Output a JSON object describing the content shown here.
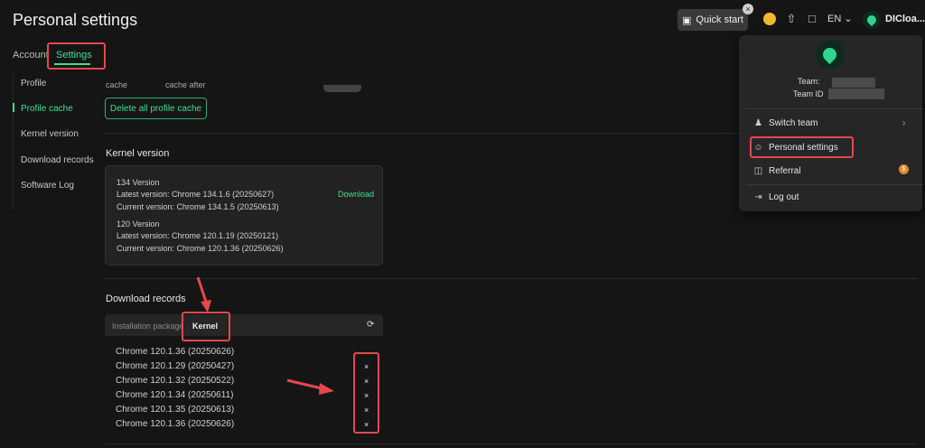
{
  "header": {
    "title": "Personal settings",
    "quick_start": "Quick start",
    "language": "EN",
    "user_name": "DICloa..."
  },
  "tabs": {
    "account": "Account",
    "settings": "Settings"
  },
  "sidebar": {
    "items": [
      {
        "label": "Profile"
      },
      {
        "label": "Profile cache",
        "active": true
      },
      {
        "label": "Kernel version"
      },
      {
        "label": "Download records"
      },
      {
        "label": "Software Log"
      }
    ]
  },
  "profile_cache": {
    "cut_label_1": "cache",
    "cut_label_2": "cache after",
    "delete_button": "Delete all profile cache"
  },
  "kernel_version": {
    "title": "Kernel version",
    "download_label": "Download",
    "versions": [
      {
        "name": "134 Version",
        "latest": "Latest version: Chrome 134.1.6 (20250627)",
        "current": "Current version: Chrome 134.1.5 (20250613)"
      },
      {
        "name": "120 Version",
        "latest": "Latest version: Chrome 120.1.19 (20250121)",
        "current": "Current version: Chrome 120.1.36 (20250626)"
      }
    ]
  },
  "download_records": {
    "title": "Download records",
    "tab_installation": "Installation package",
    "tab_kernel": "Kernel",
    "records": [
      "Chrome 120.1.36 (20250626)",
      "Chrome 120.1.29 (20250427)",
      "Chrome 120.1.32 (20250522)",
      "Chrome 120.1.34 (20250611)",
      "Chrome 120.1.35 (20250613)",
      "Chrome 120.1.36 (20250626)"
    ],
    "delete_glyph": "×"
  },
  "dropdown": {
    "team_label": "Team:",
    "team_id_label": "Team ID",
    "items": {
      "switch_team": "Switch team",
      "personal_settings": "Personal settings",
      "referral": "Referral",
      "log_out": "Log out"
    },
    "coin_glyph": "$"
  },
  "colors": {
    "accent": "#3ee08e",
    "highlight": "#e5484d",
    "background": "#151515"
  }
}
